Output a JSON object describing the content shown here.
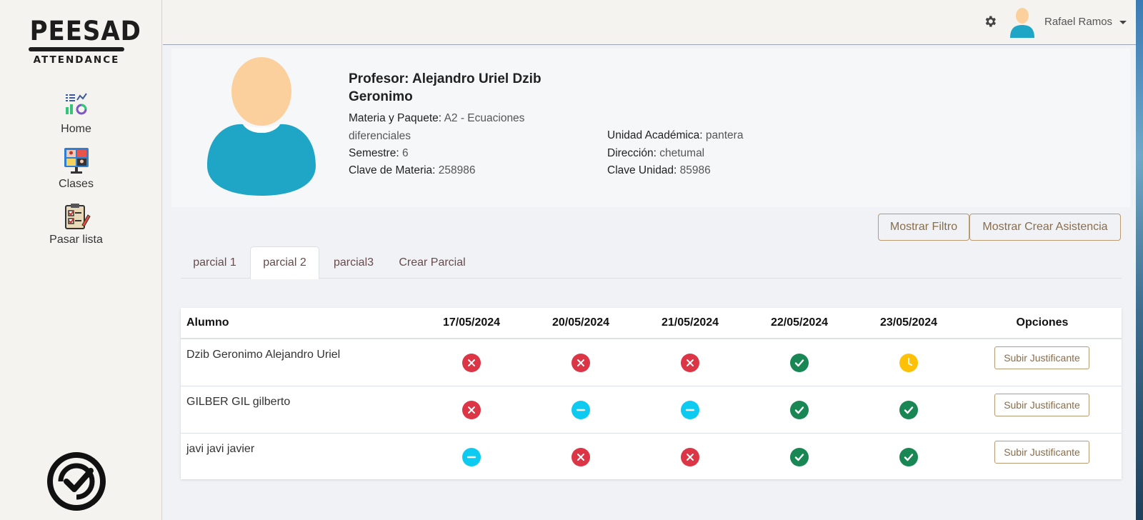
{
  "sidebar": {
    "logo": {
      "title": "PEESAD",
      "subtitle": "ATTENDANCE"
    },
    "items": [
      {
        "label": "Home",
        "icon": "dashboard-icon"
      },
      {
        "label": "Clases",
        "icon": "classroom-icon"
      },
      {
        "label": "Pasar lista",
        "icon": "checklist-icon"
      }
    ],
    "bottom_icon": "badge-check-icon"
  },
  "topbar": {
    "settings_icon": "gear-icon",
    "user_name": "Rafael Ramos",
    "dropdown_icon": "caret-down-icon"
  },
  "profile": {
    "name": "Profesor: Alejandro Uriel Dzib Geronimo",
    "materia_label": "Materia y Paquete:",
    "materia_value": "A2 - Ecuaciones diferenciales",
    "semestre_label": "Semestre:",
    "semestre_value": "6",
    "clave_materia_label": "Clave de Materia:",
    "clave_materia_value": "258986",
    "unidad_label": "Unidad Académica:",
    "unidad_value": "pantera",
    "direccion_label": "Dirección:",
    "direccion_value": "chetumal",
    "clave_unidad_label": "Clave Unidad:",
    "clave_unidad_value": "85986"
  },
  "actions": {
    "filter_label": "Mostrar Filtro",
    "create_attendance_label": "Mostrar Crear Asistencia"
  },
  "tabs": [
    {
      "label": "parcial 1",
      "active": false
    },
    {
      "label": "parcial 2",
      "active": true
    },
    {
      "label": "parcial3",
      "active": false
    },
    {
      "label": "Crear Parcial",
      "active": false
    }
  ],
  "table": {
    "headers": [
      "Alumno",
      "17/05/2024",
      "20/05/2024",
      "21/05/2024",
      "22/05/2024",
      "23/05/2024",
      "Opciones"
    ],
    "rows": [
      {
        "student": "Dzib Geronimo Alejandro Uriel",
        "statuses": [
          "absent",
          "absent",
          "absent",
          "present",
          "late"
        ],
        "option": "Subir Justificante"
      },
      {
        "student": "GILBER GIL gilberto",
        "statuses": [
          "absent",
          "justified",
          "justified",
          "present",
          "present"
        ],
        "option": "Subir Justificante"
      },
      {
        "student": "javi javi javier",
        "statuses": [
          "justified",
          "absent",
          "absent",
          "present",
          "present"
        ],
        "option": "Subir Justificante"
      }
    ]
  },
  "colors": {
    "absent": "#dc3545",
    "present": "#198754",
    "late": "#ffc107",
    "justified": "#0dcaf0",
    "accent": "#8a6d4a",
    "avatar_skin": "#fcd09c",
    "avatar_body": "#1fa6c6"
  }
}
